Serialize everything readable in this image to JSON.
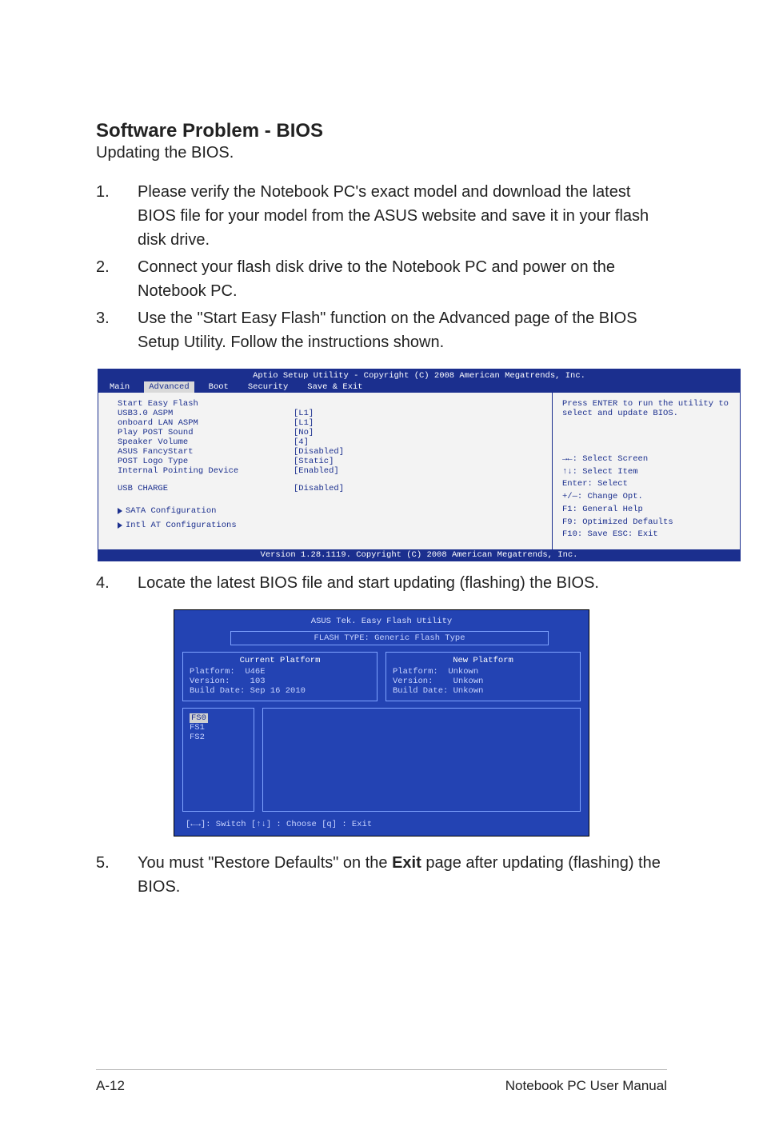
{
  "title": "Software Problem - BIOS",
  "subtitle": "Updating the BIOS.",
  "steps": {
    "s1": {
      "num": "1.",
      "text": "Please verify the Notebook PC's exact model and download the latest BIOS file for your model from the ASUS website and save it in your flash disk drive."
    },
    "s2": {
      "num": "2.",
      "text": "Connect your flash disk drive to the Notebook PC and power on the Notebook PC."
    },
    "s3": {
      "num": "3.",
      "text": "Use the \"Start Easy Flash\" function on the Advanced page of the BIOS Setup Utility. Follow the instructions shown."
    },
    "s4": {
      "num": "4.",
      "text": "Locate the latest BIOS file and start updating (flashing) the BIOS."
    },
    "s5": {
      "num": "5.",
      "text_pre": "You must \"Restore Defaults\" on the ",
      "bold": "Exit",
      "text_post": " page after updating (flashing) the BIOS."
    }
  },
  "bios": {
    "header": "Aptio Setup Utility - Copyright (C) 2008 American Megatrends, Inc.",
    "tabs": {
      "main": "Main",
      "advanced": "Advanced",
      "boot": "Boot",
      "security": "Security",
      "save": "Save & Exit"
    },
    "rows": [
      {
        "label": "Start Easy Flash",
        "val": ""
      },
      {
        "label": "USB3.0 ASPM",
        "val": "[L1]"
      },
      {
        "label": "onboard LAN ASPM",
        "val": "[L1]"
      },
      {
        "label": "Play POST Sound",
        "val": "[No]"
      },
      {
        "label": "Speaker Volume",
        "val": "[4]"
      },
      {
        "label": "ASUS FancyStart",
        "val": "[Disabled]"
      },
      {
        "label": "POST Logo Type",
        "val": "[Static]"
      },
      {
        "label": "Internal Pointing Device",
        "val": "[Enabled]"
      }
    ],
    "usb": {
      "label": "USB CHARGE",
      "val": "[Disabled]"
    },
    "sub1": "SATA Configuration",
    "sub2": "Intl AT Configurations",
    "help_top": "Press ENTER to run the utility to select and update BIOS.",
    "help_bottom": [
      "→←: Select Screen",
      "↑↓:    Select Item",
      "Enter: Select",
      "+/—:  Change Opt.",
      "F1:    General Help",
      "F9:    Optimized Defaults",
      "F10:  Save    ESC: Exit"
    ],
    "footer": "Version 1.28.1119. Copyright (C) 2008 American Megatrends, Inc."
  },
  "flash": {
    "title": "ASUS Tek. Easy Flash Utility",
    "type": "FLASH TYPE: Generic Flash Type",
    "cur": {
      "title": "Current Platform",
      "platform_l": "Platform:",
      "platform_v": "U46E",
      "version_l": "Version:",
      "version_v": "103",
      "build_l": "Build Date:",
      "build_v": "Sep 16 2010"
    },
    "new": {
      "title": "New Platform",
      "platform_l": "Platform:",
      "platform_v": "Unkown",
      "version_l": "Version:",
      "version_v": "Unkown",
      "build_l": "Build Date:",
      "build_v": "Unkown"
    },
    "fs": {
      "fs0": "FS0",
      "fs1": "FS1",
      "fs2": "FS2"
    },
    "hint": "[←→]: Switch   [↑↓] : Choose   [q] : Exit"
  },
  "footer": {
    "left": "A-12",
    "right": "Notebook PC User Manual"
  }
}
